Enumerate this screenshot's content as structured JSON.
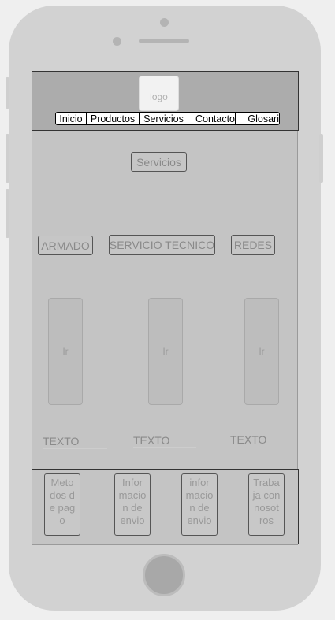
{
  "header": {
    "logo_label": "logo",
    "nav": [
      "Inicio",
      "Productos",
      "Servicios",
      "Contacto",
      "Glosari"
    ]
  },
  "main": {
    "section_button": "Servicios",
    "categories": [
      "ARMADO",
      "SERVICIO TECNICO",
      "REDES"
    ],
    "image_placeholders": [
      "Ir",
      "Ir",
      "Ir"
    ],
    "texts": [
      "TEXTO",
      "TEXTO",
      "TEXTO"
    ]
  },
  "footer": {
    "items": [
      "Metodos de pago",
      "Informacion de envio",
      "informacion de envio",
      "Trabaja con nosotros"
    ]
  }
}
